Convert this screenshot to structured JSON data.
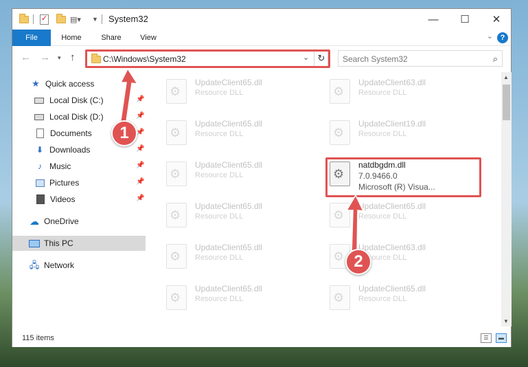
{
  "window": {
    "title": "System32"
  },
  "ribbon": {
    "tabs": [
      "File",
      "Home",
      "Share",
      "View"
    ]
  },
  "address": {
    "path": "C:\\Windows\\System32"
  },
  "search": {
    "placeholder": "Search System32"
  },
  "nav": {
    "quick_access": "Quick access",
    "items": [
      {
        "label": "Local Disk (C:)",
        "icon": "drive-icon"
      },
      {
        "label": "Local Disk (D:)",
        "icon": "drive-icon"
      },
      {
        "label": "Documents",
        "icon": "documents-icon"
      },
      {
        "label": "Downloads",
        "icon": "downloads-icon"
      },
      {
        "label": "Music",
        "icon": "music-icon"
      },
      {
        "label": "Pictures",
        "icon": "pictures-icon"
      },
      {
        "label": "Videos",
        "icon": "videos-icon"
      }
    ],
    "onedrive": "OneDrive",
    "this_pc": "This PC",
    "network": "Network"
  },
  "files": [
    {
      "name": "UpdateClient65.dll",
      "type": "Resource DLL"
    },
    {
      "name": "UpdateClient63.dll",
      "type": "Resource DLL"
    },
    {
      "name": "UpdateClient65.dll",
      "type": "Resource DLL"
    },
    {
      "name": "UpdateClient19.dll",
      "type": "Resource DLL"
    },
    {
      "name": "UpdateClient65.dll",
      "type": "Resource DLL"
    },
    {
      "name": "natdbgdm.dll",
      "version": "7.0.9466.0",
      "type": "Microsoft (R) Visua..."
    },
    {
      "name": "UpdateClient65.dll",
      "type": "Resource DLL"
    },
    {
      "name": "UpdateClient65.dll",
      "type": "Resource DLL"
    },
    {
      "name": "UpdateClient65.dll",
      "type": "Resource DLL"
    },
    {
      "name": "UpdateClient63.dll",
      "type": "Resource DLL"
    },
    {
      "name": "UpdateClient65.dll",
      "type": "Resource DLL"
    },
    {
      "name": "UpdateClient65.dll",
      "type": "Resource DLL"
    }
  ],
  "status": {
    "count": "115 items"
  },
  "callouts": {
    "one": "1",
    "two": "2"
  },
  "colors": {
    "accent": "#1979ca",
    "highlight": "#e05353"
  }
}
